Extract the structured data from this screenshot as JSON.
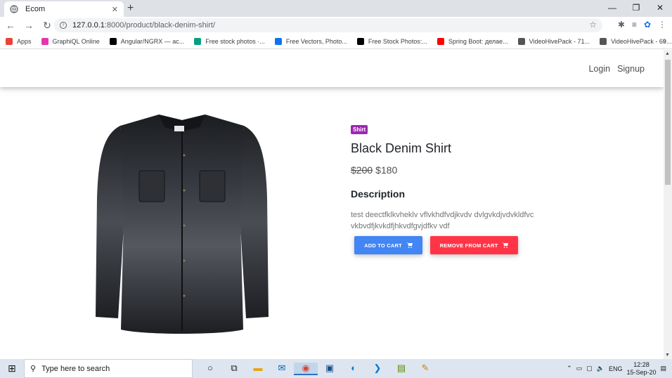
{
  "browser": {
    "tab_title": "Ecom",
    "url_host": "127.0.0.1",
    "url_rest": ":8000/product/black-denim-shirt/",
    "bookmarks": [
      {
        "label": "Apps",
        "color": "#ea4335"
      },
      {
        "label": "GraphiQL Online",
        "color": "#e535ab"
      },
      {
        "label": "Angular/NGRX — ас...",
        "color": "#000000"
      },
      {
        "label": "Free stock photos ·...",
        "color": "#05a081"
      },
      {
        "label": "Free Vectors, Photo...",
        "color": "#1273eb"
      },
      {
        "label": "Free Stock Photos:...",
        "color": "#000000"
      },
      {
        "label": "Spring Boot: делае...",
        "color": "#ff0000"
      },
      {
        "label": "VideoHivePack - 71...",
        "color": "#555555"
      },
      {
        "label": "VideoHivePack - 69...",
        "color": "#555555"
      }
    ]
  },
  "nav": {
    "login": "Login",
    "signup": "Signup"
  },
  "product": {
    "category": "Shirt",
    "name": "Black Denim Shirt",
    "old_price": "$200",
    "price": "$180",
    "description_heading": "Description",
    "description": "test deectfklkvheklv vflvkhdfvdjkvdv dvlgvkdjvdvkldfvc vkbvdfjkvkdfjhkvdfgvjdfkv vdf",
    "add_to_cart": "ADD TO CART",
    "remove_from_cart": "REMOVE FROM CART",
    "colors": {
      "badge": "#9c27b0",
      "add": "#4285f4",
      "remove": "#ff3547"
    }
  },
  "taskbar": {
    "search_placeholder": "Type here to search",
    "language": "ENG",
    "time": "12:28",
    "date": "15-Sep-20"
  }
}
